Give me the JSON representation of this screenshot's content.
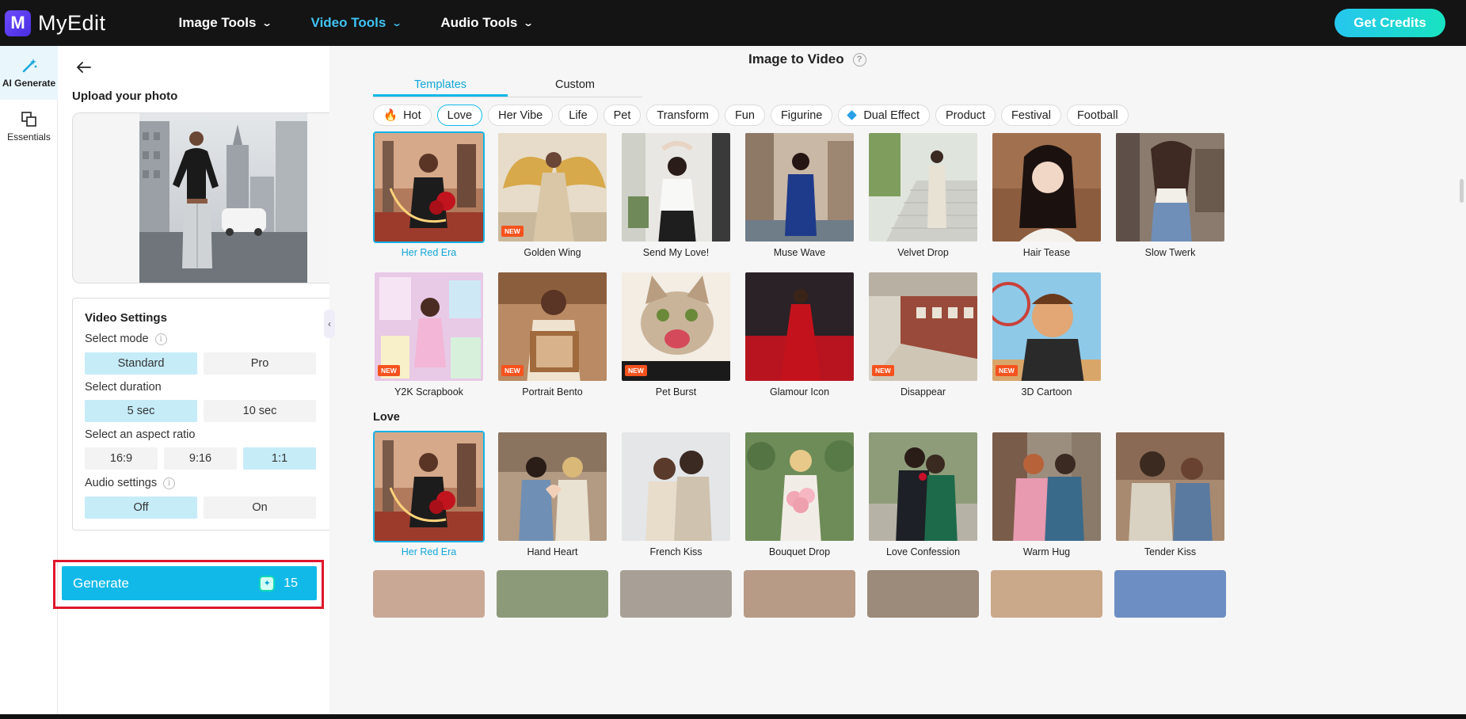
{
  "app": {
    "name": "MyEdit"
  },
  "nav": {
    "items": [
      {
        "label": "Image Tools",
        "active": false
      },
      {
        "label": "Video Tools",
        "active": true
      },
      {
        "label": "Audio Tools",
        "active": false
      }
    ],
    "cta": "Get Credits"
  },
  "rail": {
    "items": [
      {
        "label": "AI Generate",
        "icon": "magic-wand-icon",
        "active": true
      },
      {
        "label": "Essentials",
        "icon": "layers-icon",
        "active": false
      }
    ]
  },
  "panel": {
    "upload_title": "Upload your photo",
    "settings_title": "Video Settings",
    "mode": {
      "label": "Select mode",
      "options": [
        "Standard",
        "Pro"
      ],
      "selected": "Standard"
    },
    "duration": {
      "label": "Select duration",
      "options": [
        "5 sec",
        "10 sec"
      ],
      "selected": "5 sec"
    },
    "aspect": {
      "label": "Select an aspect ratio",
      "options": [
        "16:9",
        "9:16",
        "1:1"
      ],
      "selected": "1:1"
    },
    "audio": {
      "label": "Audio settings",
      "options": [
        "Off",
        "On"
      ],
      "selected": "Off"
    },
    "generate_label": "Generate",
    "generate_cost": "15"
  },
  "main": {
    "title": "Image to Video",
    "tabs": [
      {
        "label": "Templates",
        "active": true
      },
      {
        "label": "Custom",
        "active": false
      }
    ],
    "chips": [
      {
        "label": "Hot",
        "icon": "flame-icon"
      },
      {
        "label": "Love",
        "active": true
      },
      {
        "label": "Her Vibe"
      },
      {
        "label": "Life"
      },
      {
        "label": "Pet"
      },
      {
        "label": "Transform"
      },
      {
        "label": "Fun"
      },
      {
        "label": "Figurine"
      },
      {
        "label": "Dual Effect",
        "icon": "diamond-icon"
      },
      {
        "label": "Product"
      },
      {
        "label": "Festival"
      },
      {
        "label": "Football"
      }
    ],
    "hot_row1": [
      {
        "label": "Her Red Era",
        "selected": true
      },
      {
        "label": "Golden Wing",
        "badge": "NEW"
      },
      {
        "label": "Send My Love!"
      },
      {
        "label": "Muse Wave"
      },
      {
        "label": "Velvet Drop"
      },
      {
        "label": "Hair Tease"
      },
      {
        "label": "Slow Twerk"
      }
    ],
    "hot_row2": [
      {
        "label": "Y2K Scrapbook",
        "badge": "NEW"
      },
      {
        "label": "Portrait Bento",
        "badge": "NEW"
      },
      {
        "label": "Pet Burst",
        "badge": "NEW"
      },
      {
        "label": "Glamour Icon"
      },
      {
        "label": "Disappear",
        "badge": "NEW"
      },
      {
        "label": "3D Cartoon",
        "badge": "NEW"
      }
    ],
    "love_section": "Love",
    "love_row": [
      {
        "label": "Her Red Era",
        "selected": true
      },
      {
        "label": "Hand Heart"
      },
      {
        "label": "French Kiss"
      },
      {
        "label": "Bouquet Drop"
      },
      {
        "label": "Love Confession"
      },
      {
        "label": "Warm Hug"
      },
      {
        "label": "Tender Kiss"
      }
    ]
  }
}
